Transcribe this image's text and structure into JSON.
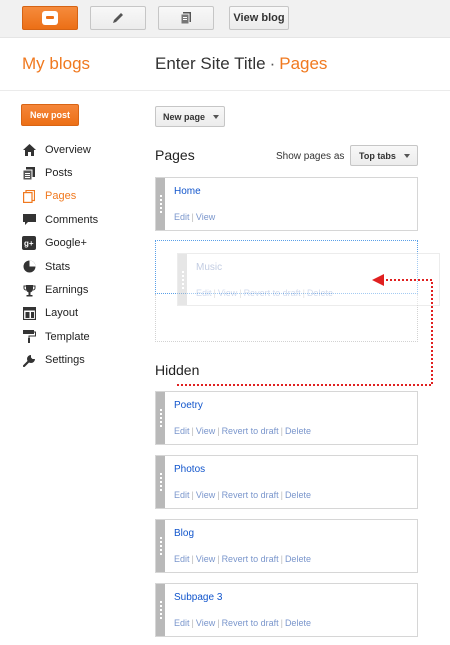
{
  "topbar": {
    "blogger_icon": "blogger-logo-icon",
    "pencil_icon": "pencil-icon",
    "pages_icon": "pages-icon",
    "view_blog_label": "View blog"
  },
  "header": {
    "my_blogs": "My blogs",
    "site_title": "Enter Site Title",
    "separator": "·",
    "section": "Pages"
  },
  "sidebar": {
    "new_post_label": "New post",
    "items": [
      {
        "label": "Overview",
        "icon": "home-icon",
        "active": false
      },
      {
        "label": "Posts",
        "icon": "posts-icon",
        "active": false
      },
      {
        "label": "Pages",
        "icon": "pages-icon",
        "active": true
      },
      {
        "label": "Comments",
        "icon": "comment-icon",
        "active": false
      },
      {
        "label": "Google+",
        "icon": "google-plus-icon",
        "active": false
      },
      {
        "label": "Stats",
        "icon": "pie-chart-icon",
        "active": false
      },
      {
        "label": "Earnings",
        "icon": "trophy-icon",
        "active": false
      },
      {
        "label": "Layout",
        "icon": "layout-icon",
        "active": false
      },
      {
        "label": "Template",
        "icon": "paint-roller-icon",
        "active": false
      },
      {
        "label": "Settings",
        "icon": "wrench-icon",
        "active": false
      }
    ]
  },
  "main": {
    "new_page_label": "New page",
    "pages_heading": "Pages",
    "show_pages_as_label": "Show pages as",
    "show_pages_as_value": "Top tabs",
    "visible_pages": [
      {
        "title": "Home",
        "actions": [
          "Edit",
          "View"
        ]
      }
    ],
    "dragging_page": {
      "title": "Music",
      "actions": [
        "Edit",
        "View",
        "Revert to draft",
        "Delete"
      ]
    },
    "hidden_heading": "Hidden",
    "hidden_pages": [
      {
        "title": "Poetry",
        "actions": [
          "Edit",
          "View",
          "Revert to draft",
          "Delete"
        ]
      },
      {
        "title": "Photos",
        "actions": [
          "Edit",
          "View",
          "Revert to draft",
          "Delete"
        ]
      },
      {
        "title": "Blog",
        "actions": [
          "Edit",
          "View",
          "Revert to draft",
          "Delete"
        ]
      },
      {
        "title": "Subpage 3",
        "actions": [
          "Edit",
          "View",
          "Revert to draft",
          "Delete"
        ]
      }
    ]
  },
  "colors": {
    "accent": "#f0791f",
    "link": "#1155cc",
    "drag_arrow": "#e02020"
  }
}
